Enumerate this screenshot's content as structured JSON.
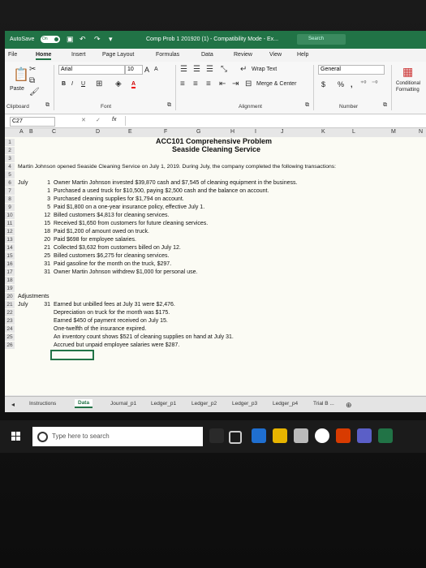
{
  "titlebar": {
    "autosave": "AutoSave",
    "autosave_state": "On",
    "filename": "Comp Prob 1 201920 (1)  -  Compatibility Mode  -  Ex...",
    "search": "Search"
  },
  "tabs": [
    "File",
    "Home",
    "Insert",
    "Page Layout",
    "Formulas",
    "Data",
    "Review",
    "View",
    "Help"
  ],
  "ribbon": {
    "paste": "Paste",
    "font_name": "Arial",
    "font_size": "10",
    "bold": "B",
    "italic": "I",
    "underline": "U",
    "grow": "A",
    "shrink": "A",
    "font_color": "A",
    "wrap_text": "Wrap Text",
    "merge_center": "Merge & Center",
    "number_format": "General",
    "currency": "$",
    "percent": "%",
    "comma": ",",
    "conditional": "Conditional",
    "formatting": "Formatting",
    "groups": {
      "clipboard": "Clipboard",
      "font": "Font",
      "alignment": "Alignment",
      "number": "Number"
    }
  },
  "formula_bar": {
    "name_box": "C27",
    "cancel": "✕",
    "enter": "✓",
    "fx": "fx"
  },
  "columns": [
    "A",
    "B",
    "C",
    "D",
    "E",
    "F",
    "G",
    "H",
    "I",
    "J",
    "K",
    "L",
    "M",
    "N"
  ],
  "rows": [
    "1",
    "2",
    "3",
    "4",
    "5",
    "6",
    "7",
    "8",
    "9",
    "10",
    "11",
    "12",
    "13",
    "14",
    "15",
    "16",
    "17",
    "18",
    "19",
    "20",
    "21",
    "22",
    "23",
    "24",
    "25",
    "26"
  ],
  "sheet": {
    "title": "ACC101 Comprehensive Problem",
    "subtitle": "Seaside Cleaning Service",
    "intro": "Martin Johnson opened Seaside Cleaning Service on July 1, 2019. During July, the company completed the following transactions:",
    "month": "July",
    "transactions": [
      {
        "day": "1",
        "text": "Owner Martin Johnson invested $39,870 cash and $7,545 of cleaning equipment in the business."
      },
      {
        "day": "1",
        "text": "Purchased a used truck for $10,500, paying $2,500 cash and the balance on account."
      },
      {
        "day": "3",
        "text": "Purchased cleaning supplies for $1,794 on account."
      },
      {
        "day": "5",
        "text": "Paid $1,800 on a one-year insurance policy, effective July 1."
      },
      {
        "day": "12",
        "text": "Billed customers $4,813 for cleaning services."
      },
      {
        "day": "15",
        "text": "Received $1,650 from customers for future cleaning services."
      },
      {
        "day": "18",
        "text": "Paid $1,200 of amount owed on truck."
      },
      {
        "day": "20",
        "text": "Paid $698 for employee salaries."
      },
      {
        "day": "21",
        "text": "Collected $3,632 from customers billed on July 12."
      },
      {
        "day": "25",
        "text": "Billed customers $6,275 for cleaning services."
      },
      {
        "day": "31",
        "text": "Paid gasoline for the month on the truck, $297."
      },
      {
        "day": "31",
        "text": "Owner Martin Johnson withdrew $1,000 for personal use."
      }
    ],
    "adjustments_label": "Adjustments",
    "adj_month": "July",
    "adj_day": "31",
    "adjustments": [
      "Earned but unbilled fees at July 31 were $2,476.",
      "Depreciation on truck for the month was $175.",
      "Earned $450 of payment received on July 15.",
      "One-twelfth of the insurance expired.",
      "An inventory count shows $521 of cleaning supplies on hand at July 31.",
      "Accrued but unpaid employee salaries were $287."
    ]
  },
  "sheet_tabs": [
    "Instructions",
    "Data",
    "Journal_p1",
    "Ledger_p1",
    "Ledger_p2",
    "Ledger_p3",
    "Ledger_p4",
    "Trial B ..."
  ],
  "taskbar": {
    "search_placeholder": "Type here to search"
  }
}
